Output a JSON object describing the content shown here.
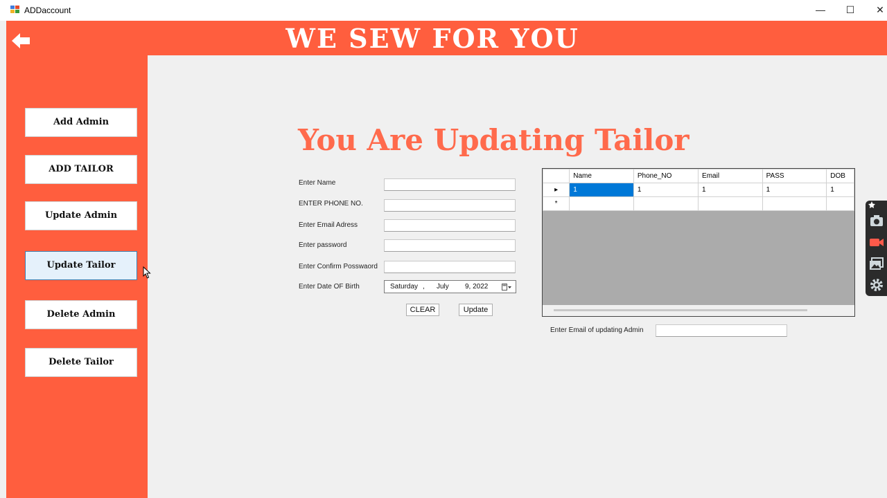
{
  "window": {
    "title": "ADDaccount",
    "minimize": "—",
    "maximize": "☐",
    "close": "✕"
  },
  "header": {
    "brand": "WE SEW FOR YOU"
  },
  "sidebar": {
    "buttons": [
      "Add Admin",
      "ADD TAILOR",
      "Update Admin",
      "Update Tailor",
      "Delete Admin",
      "Delete Tailor"
    ]
  },
  "main": {
    "title": "You Are Updating Tailor",
    "form": {
      "name_label": "Enter Name",
      "phone_label": "ENTER PHONE NO.",
      "email_label": "Enter Email Adress",
      "password_label": "Enter password",
      "confirm_label": "Enter Confirm Posswaord",
      "dob_label": "Enter Date OF Birth",
      "dob_weekday": "Saturday",
      "dob_sep": ",",
      "dob_month": "July",
      "dob_day_year": "9, 2022"
    },
    "buttons": {
      "clear": "CLEAR",
      "update": "Update"
    },
    "grid": {
      "columns": [
        "Name",
        "Phone_NO",
        "Email",
        "PASS",
        "DOB"
      ],
      "rows": [
        [
          "1",
          "1",
          "1",
          "1",
          "1"
        ]
      ],
      "row_marker": "▸",
      "new_row_marker": "*"
    },
    "email_lookup_label": "Enter Email of updating Admin"
  },
  "colors": {
    "accent": "#ff5e3e",
    "title": "#ff6a4c",
    "selection": "#0078d7"
  },
  "icons": [
    "back-arrow-icon",
    "camera-icon",
    "video-icon",
    "gallery-icon",
    "settings-icon",
    "pin-icon"
  ]
}
